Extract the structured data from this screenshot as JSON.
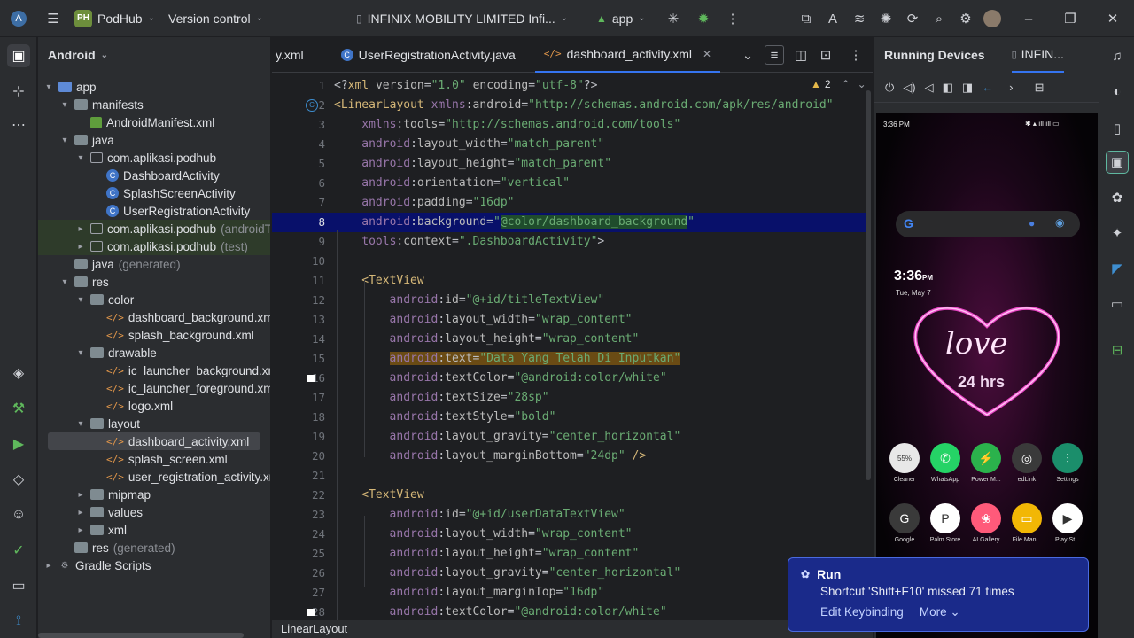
{
  "titlebar": {
    "project_badge": "PH",
    "project_name": "PodHub",
    "vcs": "Version control",
    "device": "INFINIX MOBILITY LIMITED Infi...",
    "run_config": "app"
  },
  "project_panel": {
    "title": "Android",
    "tree": [
      {
        "label": "app",
        "indent": 0,
        "arrow": "▾",
        "icon": "folder-blue"
      },
      {
        "label": "manifests",
        "indent": 1,
        "arrow": "▾",
        "icon": "folder"
      },
      {
        "label": "AndroidManifest.xml",
        "indent": 2,
        "arrow": "",
        "icon": "manifest"
      },
      {
        "label": "java",
        "indent": 1,
        "arrow": "▾",
        "icon": "folder"
      },
      {
        "label": "com.aplikasi.podhub",
        "indent": 2,
        "arrow": "▾",
        "icon": "package"
      },
      {
        "label": "DashboardActivity",
        "indent": 3,
        "arrow": "",
        "icon": "class"
      },
      {
        "label": "SplashScreenActivity",
        "indent": 3,
        "arrow": "",
        "icon": "class"
      },
      {
        "label": "UserRegistrationActivity",
        "indent": 3,
        "arrow": "",
        "icon": "class"
      },
      {
        "label": "com.aplikasi.podhub",
        "suffix": "(androidT",
        "indent": 2,
        "arrow": "▸",
        "icon": "package"
      },
      {
        "label": "com.aplikasi.podhub",
        "suffix": "(test)",
        "indent": 2,
        "arrow": "▸",
        "icon": "package"
      },
      {
        "label": "java",
        "suffix": "(generated)",
        "indent": 1,
        "arrow": "",
        "icon": "folder"
      },
      {
        "label": "res",
        "indent": 1,
        "arrow": "▾",
        "icon": "folder"
      },
      {
        "label": "color",
        "indent": 2,
        "arrow": "▾",
        "icon": "folder"
      },
      {
        "label": "dashboard_background.xm",
        "indent": 3,
        "arrow": "",
        "icon": "xml"
      },
      {
        "label": "splash_background.xml",
        "indent": 3,
        "arrow": "",
        "icon": "xml"
      },
      {
        "label": "drawable",
        "indent": 2,
        "arrow": "▾",
        "icon": "folder"
      },
      {
        "label": "ic_launcher_background.xm",
        "indent": 3,
        "arrow": "",
        "icon": "xml"
      },
      {
        "label": "ic_launcher_foreground.xml",
        "indent": 3,
        "arrow": "",
        "icon": "xml"
      },
      {
        "label": "logo.xml",
        "indent": 3,
        "arrow": "",
        "icon": "xml"
      },
      {
        "label": "layout",
        "indent": 2,
        "arrow": "▾",
        "icon": "folder"
      },
      {
        "label": "dashboard_activity.xml",
        "indent": 3,
        "arrow": "",
        "icon": "xml"
      },
      {
        "label": "splash_screen.xml",
        "indent": 3,
        "arrow": "",
        "icon": "xml"
      },
      {
        "label": "user_registration_activity.xr",
        "indent": 3,
        "arrow": "",
        "icon": "xml"
      },
      {
        "label": "mipmap",
        "indent": 2,
        "arrow": "▸",
        "icon": "folder"
      },
      {
        "label": "values",
        "indent": 2,
        "arrow": "▸",
        "icon": "folder"
      },
      {
        "label": "xml",
        "indent": 2,
        "arrow": "▸",
        "icon": "folder"
      },
      {
        "label": "res",
        "suffix": "(generated)",
        "indent": 1,
        "arrow": "",
        "icon": "folder"
      },
      {
        "label": "Gradle Scripts",
        "indent": 0,
        "arrow": "▸",
        "icon": "gradle"
      }
    ]
  },
  "editor": {
    "tabs": [
      {
        "label": "y.xml",
        "icon": ""
      },
      {
        "label": "UserRegistrationActivity.java",
        "icon": "class"
      },
      {
        "label": "dashboard_activity.xml",
        "icon": "xml",
        "active": true
      }
    ],
    "warnings": "2",
    "current_line": "8",
    "lines": [
      {
        "n": "1",
        "indent": 0,
        "parts": [
          [
            "pun",
            "<?"
          ],
          [
            "tag",
            "xml "
          ],
          [
            "attr",
            "version"
          ],
          [
            "pun",
            "="
          ],
          [
            "str",
            "\"1.0\" "
          ],
          [
            "attr",
            "encoding"
          ],
          [
            "pun",
            "="
          ],
          [
            "str",
            "\"utf-8\""
          ],
          [
            "pun",
            "?>"
          ]
        ]
      },
      {
        "n": "2",
        "indent": 0,
        "parts": [
          [
            "tag",
            "<LinearLayout "
          ],
          [
            "ns",
            "xmlns"
          ],
          [
            "pun",
            ":"
          ],
          [
            "attr",
            "android"
          ],
          [
            "pun",
            "="
          ],
          [
            "str",
            "\"http://schemas.android.com/apk/res/android\""
          ]
        ]
      },
      {
        "n": "3",
        "indent": 1,
        "parts": [
          [
            "ns",
            "xmlns"
          ],
          [
            "pun",
            ":"
          ],
          [
            "attr",
            "tools"
          ],
          [
            "pun",
            "="
          ],
          [
            "str",
            "\"http://schemas.android.com/tools\""
          ]
        ]
      },
      {
        "n": "4",
        "indent": 1,
        "parts": [
          [
            "ns",
            "android"
          ],
          [
            "pun",
            ":"
          ],
          [
            "attr",
            "layout_width"
          ],
          [
            "pun",
            "="
          ],
          [
            "str",
            "\"match_parent\""
          ]
        ]
      },
      {
        "n": "5",
        "indent": 1,
        "parts": [
          [
            "ns",
            "android"
          ],
          [
            "pun",
            ":"
          ],
          [
            "attr",
            "layout_height"
          ],
          [
            "pun",
            "="
          ],
          [
            "str",
            "\"match_parent\""
          ]
        ]
      },
      {
        "n": "6",
        "indent": 1,
        "parts": [
          [
            "ns",
            "android"
          ],
          [
            "pun",
            ":"
          ],
          [
            "attr",
            "orientation"
          ],
          [
            "pun",
            "="
          ],
          [
            "str",
            "\"vertical\""
          ]
        ]
      },
      {
        "n": "7",
        "indent": 1,
        "parts": [
          [
            "ns",
            "android"
          ],
          [
            "pun",
            ":"
          ],
          [
            "attr",
            "padding"
          ],
          [
            "pun",
            "="
          ],
          [
            "str",
            "\"16dp\""
          ]
        ]
      },
      {
        "n": "8",
        "indent": 1,
        "parts": [
          [
            "ns",
            "android"
          ],
          [
            "pun",
            ":"
          ],
          [
            "attr",
            "background"
          ],
          [
            "pun",
            "="
          ],
          [
            "str",
            "\""
          ],
          [
            "col",
            "@color/dashboard_background"
          ],
          [
            "str",
            "\""
          ]
        ]
      },
      {
        "n": "9",
        "indent": 1,
        "parts": [
          [
            "ns",
            "tools"
          ],
          [
            "pun",
            ":"
          ],
          [
            "attr",
            "context"
          ],
          [
            "pun",
            "="
          ],
          [
            "str",
            "\".DashboardActivity\""
          ],
          [
            "pun",
            ">"
          ]
        ]
      },
      {
        "n": "10",
        "indent": 0,
        "parts": []
      },
      {
        "n": "11",
        "indent": 1,
        "parts": [
          [
            "tag",
            "<TextView"
          ]
        ]
      },
      {
        "n": "12",
        "indent": 2,
        "parts": [
          [
            "ns",
            "android"
          ],
          [
            "pun",
            ":"
          ],
          [
            "attr",
            "id"
          ],
          [
            "pun",
            "="
          ],
          [
            "str",
            "\"@+id/titleTextView\""
          ]
        ]
      },
      {
        "n": "13",
        "indent": 2,
        "parts": [
          [
            "ns",
            "android"
          ],
          [
            "pun",
            ":"
          ],
          [
            "attr",
            "layout_width"
          ],
          [
            "pun",
            "="
          ],
          [
            "str",
            "\"wrap_content\""
          ]
        ]
      },
      {
        "n": "14",
        "indent": 2,
        "parts": [
          [
            "ns",
            "android"
          ],
          [
            "pun",
            ":"
          ],
          [
            "attr",
            "layout_height"
          ],
          [
            "pun",
            "="
          ],
          [
            "str",
            "\"wrap_content\""
          ]
        ]
      },
      {
        "n": "15",
        "indent": 2,
        "hl": true,
        "parts": [
          [
            "ns",
            "android"
          ],
          [
            "pun",
            ":"
          ],
          [
            "attr",
            "text"
          ],
          [
            "pun",
            "="
          ],
          [
            "str",
            "\"Data Yang Telah Di Inputkan\""
          ]
        ]
      },
      {
        "n": "16",
        "indent": 2,
        "parts": [
          [
            "ns",
            "android"
          ],
          [
            "pun",
            ":"
          ],
          [
            "attr",
            "textColor"
          ],
          [
            "pun",
            "="
          ],
          [
            "str",
            "\"@android:color/white\""
          ]
        ]
      },
      {
        "n": "17",
        "indent": 2,
        "parts": [
          [
            "ns",
            "android"
          ],
          [
            "pun",
            ":"
          ],
          [
            "attr",
            "textSize"
          ],
          [
            "pun",
            "="
          ],
          [
            "str",
            "\"28sp\""
          ]
        ]
      },
      {
        "n": "18",
        "indent": 2,
        "parts": [
          [
            "ns",
            "android"
          ],
          [
            "pun",
            ":"
          ],
          [
            "attr",
            "textStyle"
          ],
          [
            "pun",
            "="
          ],
          [
            "str",
            "\"bold\""
          ]
        ]
      },
      {
        "n": "19",
        "indent": 2,
        "parts": [
          [
            "ns",
            "android"
          ],
          [
            "pun",
            ":"
          ],
          [
            "attr",
            "layout_gravity"
          ],
          [
            "pun",
            "="
          ],
          [
            "str",
            "\"center_horizontal\""
          ]
        ]
      },
      {
        "n": "20",
        "indent": 2,
        "parts": [
          [
            "ns",
            "android"
          ],
          [
            "pun",
            ":"
          ],
          [
            "attr",
            "layout_marginBottom"
          ],
          [
            "pun",
            "="
          ],
          [
            "str",
            "\"24dp\" "
          ],
          [
            "tag",
            "/>"
          ]
        ]
      },
      {
        "n": "21",
        "indent": 0,
        "parts": []
      },
      {
        "n": "22",
        "indent": 1,
        "parts": [
          [
            "tag",
            "<TextView"
          ]
        ]
      },
      {
        "n": "23",
        "indent": 2,
        "parts": [
          [
            "ns",
            "android"
          ],
          [
            "pun",
            ":"
          ],
          [
            "attr",
            "id"
          ],
          [
            "pun",
            "="
          ],
          [
            "str",
            "\"@+id/userDataTextView\""
          ]
        ]
      },
      {
        "n": "24",
        "indent": 2,
        "parts": [
          [
            "ns",
            "android"
          ],
          [
            "pun",
            ":"
          ],
          [
            "attr",
            "layout_width"
          ],
          [
            "pun",
            "="
          ],
          [
            "str",
            "\"wrap_content\""
          ]
        ]
      },
      {
        "n": "25",
        "indent": 2,
        "parts": [
          [
            "ns",
            "android"
          ],
          [
            "pun",
            ":"
          ],
          [
            "attr",
            "layout_height"
          ],
          [
            "pun",
            "="
          ],
          [
            "str",
            "\"wrap_content\""
          ]
        ]
      },
      {
        "n": "26",
        "indent": 2,
        "parts": [
          [
            "ns",
            "android"
          ],
          [
            "pun",
            ":"
          ],
          [
            "attr",
            "layout_gravity"
          ],
          [
            "pun",
            "="
          ],
          [
            "str",
            "\"center_horizontal\""
          ]
        ]
      },
      {
        "n": "27",
        "indent": 2,
        "parts": [
          [
            "ns",
            "android"
          ],
          [
            "pun",
            ":"
          ],
          [
            "attr",
            "layout_marginTop"
          ],
          [
            "pun",
            "="
          ],
          [
            "str",
            "\"16dp\""
          ]
        ]
      },
      {
        "n": "28",
        "indent": 2,
        "parts": [
          [
            "ns",
            "android"
          ],
          [
            "pun",
            ":"
          ],
          [
            "attr",
            "textColor"
          ],
          [
            "pun",
            "="
          ],
          [
            "str",
            "\"@android:color/white\""
          ]
        ]
      }
    ]
  },
  "statusbar": {
    "breadcrumb": "LinearLayout"
  },
  "devices": {
    "title": "Running Devices",
    "tab": "INFIN...",
    "phone": {
      "status_time": "3:36 PM",
      "clock": "3:36",
      "clock_suffix": "PM",
      "date": "Tue, May 7",
      "wallpaper_text1": "love",
      "wallpaper_text2": "24 hrs",
      "apps_row1": [
        {
          "label": "Cleaner",
          "glyph": "55%",
          "color": "#e8e8e8"
        },
        {
          "label": "WhatsApp",
          "glyph": "✆",
          "color": "#25d366"
        },
        {
          "label": "Power M...",
          "glyph": "⚡",
          "color": "#2bb24c"
        },
        {
          "label": "edLink",
          "glyph": "◎",
          "color": "#3a3a3a"
        },
        {
          "label": "Settings",
          "glyph": "⫶",
          "color": "#1b8e6b"
        }
      ],
      "apps_row2": [
        {
          "label": "Google",
          "glyph": "G",
          "color": "#3a3a3a"
        },
        {
          "label": "Palm Store",
          "glyph": "P",
          "color": "#ffffff"
        },
        {
          "label": "AI Gallery",
          "glyph": "❀",
          "color": "#ff5a7a"
        },
        {
          "label": "File Man...",
          "glyph": "▭",
          "color": "#f2b705"
        },
        {
          "label": "Play St...",
          "glyph": "▶",
          "color": "#ffffff"
        }
      ]
    }
  },
  "notification": {
    "title": "Run",
    "message": "Shortcut 'Shift+F10' missed 71 times",
    "action1": "Edit Keybinding",
    "action2": "More"
  }
}
